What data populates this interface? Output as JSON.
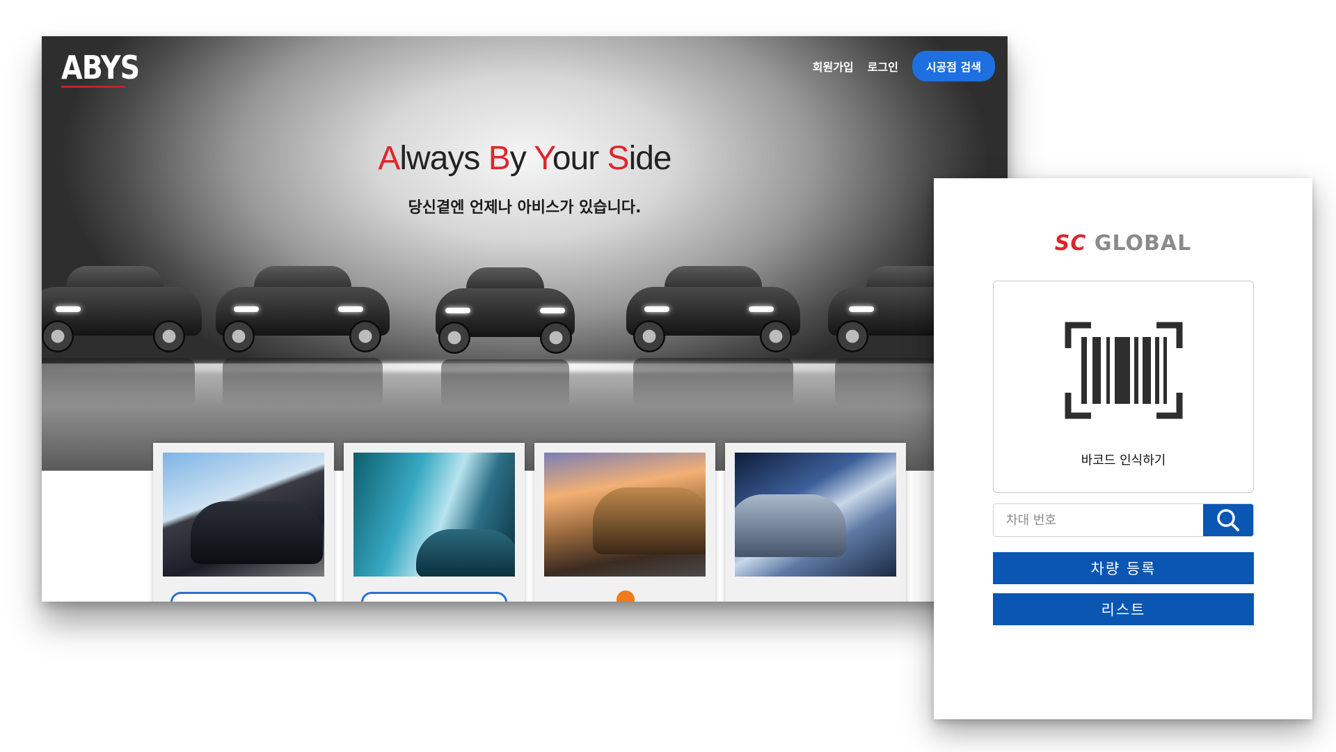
{
  "site": {
    "logo": "ABYS",
    "nav": {
      "signup": "회원가입",
      "login": "로그인",
      "find_store": "시공점 검색"
    },
    "tagline_parts": [
      {
        "text": "A",
        "accent": true
      },
      {
        "text": "lways ",
        "accent": false
      },
      {
        "text": "B",
        "accent": true
      },
      {
        "text": "y ",
        "accent": false
      },
      {
        "text": "Y",
        "accent": true
      },
      {
        "text": "our ",
        "accent": false
      },
      {
        "text": "S",
        "accent": true
      },
      {
        "text": "ide",
        "accent": false
      }
    ],
    "subtitle": "당신곁엔 언제나 아비스가 있습니다.",
    "cards": [
      {
        "photo": "car-tire-road-photo",
        "footer": "button"
      },
      {
        "photo": "car-side-mirror-photo",
        "footer": "button"
      },
      {
        "photo": "car-sunset-photo",
        "footer": "logo"
      },
      {
        "photo": "car-headlight-road-photo",
        "footer": "none"
      }
    ],
    "colors": {
      "accent_red": "#e0242b",
      "nav_button": "#1e6fe0"
    }
  },
  "panel": {
    "brand": {
      "part1": "SC",
      "part2": " GLOBAL"
    },
    "scan": {
      "icon": "barcode-scan-icon",
      "label": "바코드 인식하기"
    },
    "search": {
      "placeholder": "차대 번호",
      "value": "",
      "icon": "search-icon"
    },
    "buttons": {
      "register": "차량 등록",
      "list": "리스트"
    },
    "colors": {
      "primary": "#0b56b3",
      "brand_red": "#d9262c",
      "brand_gray": "#8a8a8a"
    }
  }
}
